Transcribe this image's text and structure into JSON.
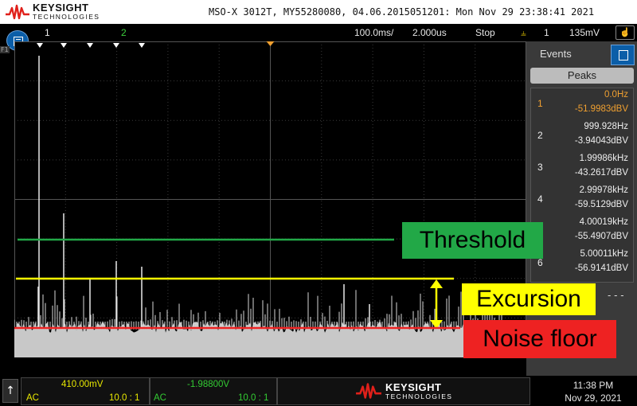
{
  "header": {
    "brand": "KEYSIGHT",
    "brand_sub": "TECHNOLOGIES",
    "model_info": "MSO-X 3012T, MY55280080, 04.06.2015051201: Mon Nov 29 23:38:41 2021"
  },
  "status": {
    "ch1_marker": "1",
    "ch2_marker": "2",
    "timebase": "100.0ms/",
    "delay": "2.000us",
    "run_state": "Stop",
    "trigger_channel": "1",
    "trigger_level": "135mV",
    "t_label": "T",
    "trigger_marker_label": "F1"
  },
  "side": {
    "events_label": "Events",
    "peaks_button": "Peaks",
    "peaks": [
      {
        "num": "1",
        "freq": "0.0Hz",
        "amp": "-51.9983dBV",
        "selected": true
      },
      {
        "num": "2",
        "freq": "999.928Hz",
        "amp": "-3.94043dBV",
        "selected": false
      },
      {
        "num": "3",
        "freq": "1.99986kHz",
        "amp": "-43.2617dBV",
        "selected": false
      },
      {
        "num": "4",
        "freq": "2.99978kHz",
        "amp": "-59.5129dBV",
        "selected": false
      },
      {
        "num": "5",
        "freq": "4.00019kHz",
        "amp": "-55.4907dBV",
        "selected": false
      },
      {
        "num": "6",
        "freq": "5.00011kHz",
        "amp": "-56.9141dBV",
        "selected": false
      }
    ],
    "more": "- - -"
  },
  "annotations": {
    "threshold": "Threshold",
    "excursion": "Excursion",
    "noise_floor": "Noise floor",
    "colors": {
      "threshold": "#22a847",
      "excursion": "#ffff00",
      "noise_floor": "#ee2222"
    }
  },
  "bottom": {
    "ch1_scale": "410.00mV",
    "ch1_coupling": "AC",
    "ch1_probe": "10.0 : 1",
    "ch2_scale": "-1.98800V",
    "ch2_coupling": "AC",
    "ch2_probe": "10.0 : 1",
    "time": "11:38 PM",
    "date": "Nov 29, 2021"
  }
}
